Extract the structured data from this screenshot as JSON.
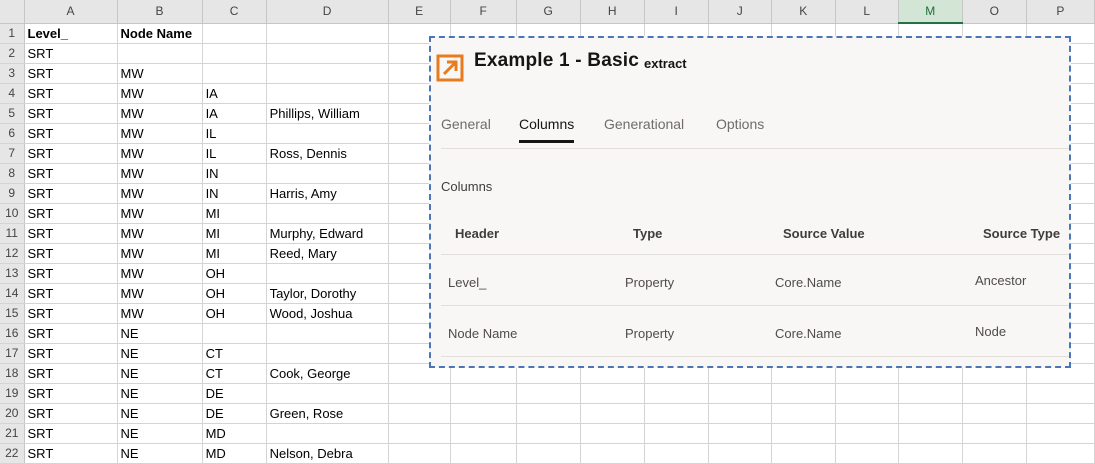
{
  "spreadsheet": {
    "columns": [
      "A",
      "B",
      "C",
      "D",
      "E",
      "F",
      "G",
      "H",
      "I",
      "J",
      "K",
      "L",
      "M",
      "O",
      "P"
    ],
    "selected_column": "M",
    "rows": [
      {
        "num": "1",
        "a": "Level_",
        "b": "Node Name",
        "c": "",
        "d": ""
      },
      {
        "num": "2",
        "a": "SRT",
        "b": "",
        "c": "",
        "d": ""
      },
      {
        "num": "3",
        "a": "SRT",
        "b": "MW",
        "c": "",
        "d": ""
      },
      {
        "num": "4",
        "a": "SRT",
        "b": "MW",
        "c": "IA",
        "d": ""
      },
      {
        "num": "5",
        "a": "SRT",
        "b": "MW",
        "c": "IA",
        "d": "Phillips, William"
      },
      {
        "num": "6",
        "a": "SRT",
        "b": "MW",
        "c": "IL",
        "d": ""
      },
      {
        "num": "7",
        "a": "SRT",
        "b": "MW",
        "c": "IL",
        "d": "Ross, Dennis"
      },
      {
        "num": "8",
        "a": "SRT",
        "b": "MW",
        "c": "IN",
        "d": ""
      },
      {
        "num": "9",
        "a": "SRT",
        "b": "MW",
        "c": "IN",
        "d": "Harris, Amy"
      },
      {
        "num": "10",
        "a": "SRT",
        "b": "MW",
        "c": "MI",
        "d": ""
      },
      {
        "num": "11",
        "a": "SRT",
        "b": "MW",
        "c": "MI",
        "d": "Murphy, Edward"
      },
      {
        "num": "12",
        "a": "SRT",
        "b": "MW",
        "c": "MI",
        "d": "Reed, Mary"
      },
      {
        "num": "13",
        "a": "SRT",
        "b": "MW",
        "c": "OH",
        "d": ""
      },
      {
        "num": "14",
        "a": "SRT",
        "b": "MW",
        "c": "OH",
        "d": "Taylor, Dorothy"
      },
      {
        "num": "15",
        "a": "SRT",
        "b": "MW",
        "c": "OH",
        "d": "Wood, Joshua"
      },
      {
        "num": "16",
        "a": "SRT",
        "b": "NE",
        "c": "",
        "d": ""
      },
      {
        "num": "17",
        "a": "SRT",
        "b": "NE",
        "c": "CT",
        "d": ""
      },
      {
        "num": "18",
        "a": "SRT",
        "b": "NE",
        "c": "CT",
        "d": "Cook, George"
      },
      {
        "num": "19",
        "a": "SRT",
        "b": "NE",
        "c": "DE",
        "d": ""
      },
      {
        "num": "20",
        "a": "SRT",
        "b": "NE",
        "c": "DE",
        "d": "Green, Rose"
      },
      {
        "num": "21",
        "a": "SRT",
        "b": "NE",
        "c": "MD",
        "d": ""
      },
      {
        "num": "22",
        "a": "SRT",
        "b": "NE",
        "c": "MD",
        "d": "Nelson, Debra"
      }
    ]
  },
  "panel": {
    "title": "Example 1 - Basic",
    "subtitle": "extract",
    "logo_icon": "export-arrow-icon",
    "accent_color": "#e87b1e",
    "border_color": "#4a76b8",
    "tabs": [
      {
        "label": "General",
        "active": false
      },
      {
        "label": "Columns",
        "active": true
      },
      {
        "label": "Generational",
        "active": false
      },
      {
        "label": "Options",
        "active": false
      }
    ],
    "section_label": "Columns",
    "grid": {
      "headers": [
        "Header",
        "Type",
        "Source Value",
        "Source Type"
      ],
      "rows": [
        {
          "header": "Level_",
          "type": "Property",
          "source_value": "Core.Name",
          "source_type": "Ancestor"
        },
        {
          "header": "Node Name",
          "type": "Property",
          "source_value": "Core.Name",
          "source_type": "Node"
        }
      ]
    }
  }
}
